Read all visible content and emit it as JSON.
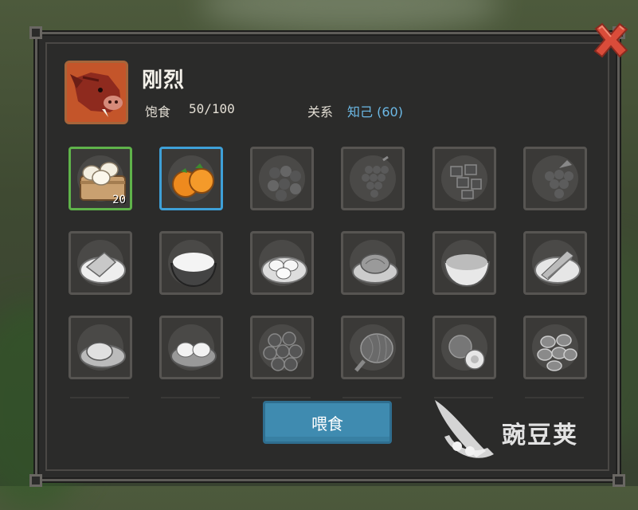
{
  "pet": {
    "name": "刚烈",
    "satiety_label": "饱食",
    "satiety_value": "50/100",
    "relation_label": "关系",
    "relation_value": "知己 (60)"
  },
  "food_items": [
    {
      "icon": "steamed-bun-basket-icon",
      "count": "20",
      "state": "selected"
    },
    {
      "icon": "tangerine-icon",
      "count": "",
      "state": "highlighted"
    },
    {
      "icon": "berries-icon",
      "count": "",
      "state": "locked"
    },
    {
      "icon": "grapes-icon",
      "count": "",
      "state": "locked"
    },
    {
      "icon": "mixed-fruit-icon",
      "count": "",
      "state": "locked"
    },
    {
      "icon": "grape-bunch-icon",
      "count": "",
      "state": "locked"
    },
    {
      "icon": "flatbread-plate-icon",
      "count": "",
      "state": "locked"
    },
    {
      "icon": "rice-bowl-icon",
      "count": "",
      "state": "locked"
    },
    {
      "icon": "dumplings-plate-icon",
      "count": "",
      "state": "locked"
    },
    {
      "icon": "cabbage-plate-icon",
      "count": "",
      "state": "locked"
    },
    {
      "icon": "soup-bowl-icon",
      "count": "",
      "state": "locked"
    },
    {
      "icon": "fish-plate-icon",
      "count": "",
      "state": "locked"
    },
    {
      "icon": "bread-plate-icon",
      "count": "",
      "state": "locked"
    },
    {
      "icon": "buns-plate-icon",
      "count": "",
      "state": "locked"
    },
    {
      "icon": "meatballs-plate-icon",
      "count": "",
      "state": "locked"
    },
    {
      "icon": "roast-leg-icon",
      "count": "",
      "state": "locked"
    },
    {
      "icon": "sliced-fruit-icon",
      "count": "",
      "state": "locked"
    },
    {
      "icon": "cookies-plate-icon",
      "count": "",
      "state": "locked"
    }
  ],
  "feed_button": {
    "label": "喂食"
  },
  "watermark": {
    "text": "豌豆荚"
  },
  "colors": {
    "panel": "#2b2b2a",
    "relation_value": "#6cb9e6",
    "selected_border": "#5fb34a",
    "highlight_border": "#3ea0d8",
    "button": "#3f8bb0",
    "close": "#d94c3a"
  }
}
